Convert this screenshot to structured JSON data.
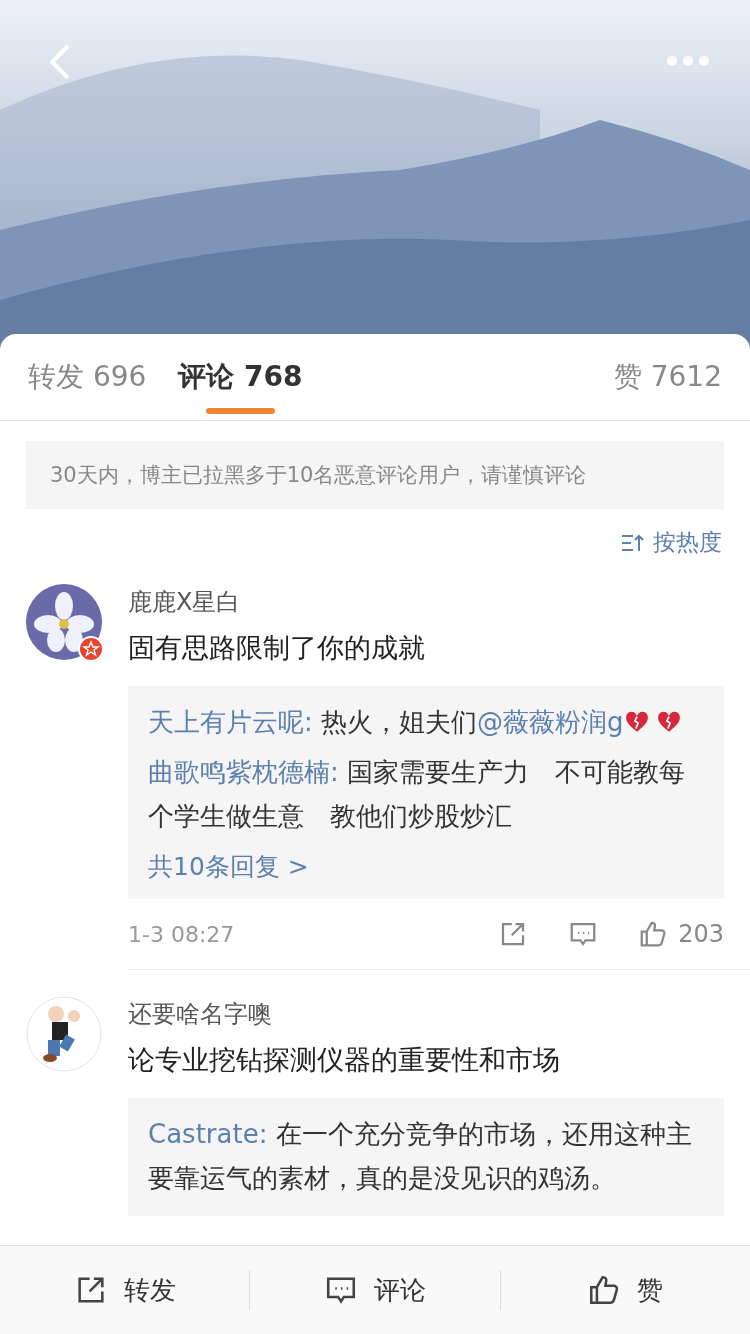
{
  "tabs": [
    {
      "label": "转发",
      "count": "696",
      "selected": false
    },
    {
      "label": "评论",
      "count": "768",
      "selected": true
    },
    {
      "label": "赞",
      "count": "7612",
      "selected": false
    }
  ],
  "notice": "30天内，博主已拉黑多于10名恶意评论用户，请谨慎评论",
  "sort": {
    "label": "按热度"
  },
  "comments": [
    {
      "avatar": {
        "kind": "flower"
      },
      "name": "鹿鹿X星白",
      "verified": true,
      "text": "固有思路限制了你的成就",
      "replies": [
        {
          "user": "天上有片云呢:",
          "segments": [
            {
              "kind": "text",
              "text": "热火，姐夫们"
            },
            {
              "kind": "mention",
              "text": "@薇薇粉润g"
            },
            {
              "kind": "broken-heart"
            },
            {
              "kind": "broken-heart"
            }
          ]
        },
        {
          "user": "曲歌鸣紫枕德楠:",
          "segments": [
            {
              "kind": "text",
              "text": "国家需要生产力　不可能教每个学生做生意　教他们炒股炒汇"
            }
          ]
        }
      ],
      "more_replies": "共10条回复 >",
      "time": "1-3 08:27",
      "likes": "203"
    },
    {
      "avatar": {
        "kind": "cartoon"
      },
      "name": "还要啥名字噢",
      "verified": false,
      "text": "论专业挖钻探测仪器的重要性和市场",
      "replies": [
        {
          "user": "Castrate:",
          "segments": [
            {
              "kind": "text",
              "text": "在一个充分竞争的市场，还用这种主要靠运气的素材，真的是没见识的鸡汤。"
            }
          ]
        }
      ]
    }
  ],
  "bottom_bar": [
    {
      "kind": "share",
      "label": "转发"
    },
    {
      "kind": "comment",
      "label": "评论"
    },
    {
      "kind": "like",
      "label": "赞"
    }
  ]
}
